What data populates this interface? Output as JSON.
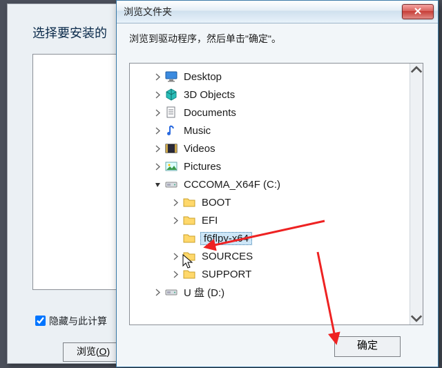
{
  "back": {
    "heading": "选择要安装的",
    "hide_checkbox_label": "隐藏与此计算",
    "hide_checked": true,
    "browse_label": "浏览",
    "browse_accel": "O"
  },
  "dialog": {
    "title": "浏览文件夹",
    "instruction": "浏览到驱动程序，然后单击\"确定\"。",
    "ok_label": "确定"
  },
  "tree": [
    {
      "depth": 1,
      "expander": "closed",
      "icon": "desktop",
      "label": "Desktop"
    },
    {
      "depth": 1,
      "expander": "closed",
      "icon": "3d",
      "label": "3D Objects"
    },
    {
      "depth": 1,
      "expander": "closed",
      "icon": "docs",
      "label": "Documents"
    },
    {
      "depth": 1,
      "expander": "closed",
      "icon": "music",
      "label": "Music"
    },
    {
      "depth": 1,
      "expander": "closed",
      "icon": "videos",
      "label": "Videos"
    },
    {
      "depth": 1,
      "expander": "closed",
      "icon": "pictures",
      "label": "Pictures"
    },
    {
      "depth": 1,
      "expander": "open",
      "icon": "drive",
      "label": "CCCOMA_X64F (C:)"
    },
    {
      "depth": 2,
      "expander": "closed",
      "icon": "folder",
      "label": "BOOT"
    },
    {
      "depth": 2,
      "expander": "closed",
      "icon": "folder",
      "label": "EFI"
    },
    {
      "depth": 2,
      "expander": "none",
      "icon": "folder",
      "label": "f6flpy-x64",
      "selected": true
    },
    {
      "depth": 2,
      "expander": "closed",
      "icon": "folder",
      "label": "SOURCES"
    },
    {
      "depth": 2,
      "expander": "closed",
      "icon": "folder",
      "label": "SUPPORT"
    },
    {
      "depth": 1,
      "expander": "closed",
      "icon": "drive",
      "label": "U 盘 (D:)"
    }
  ]
}
